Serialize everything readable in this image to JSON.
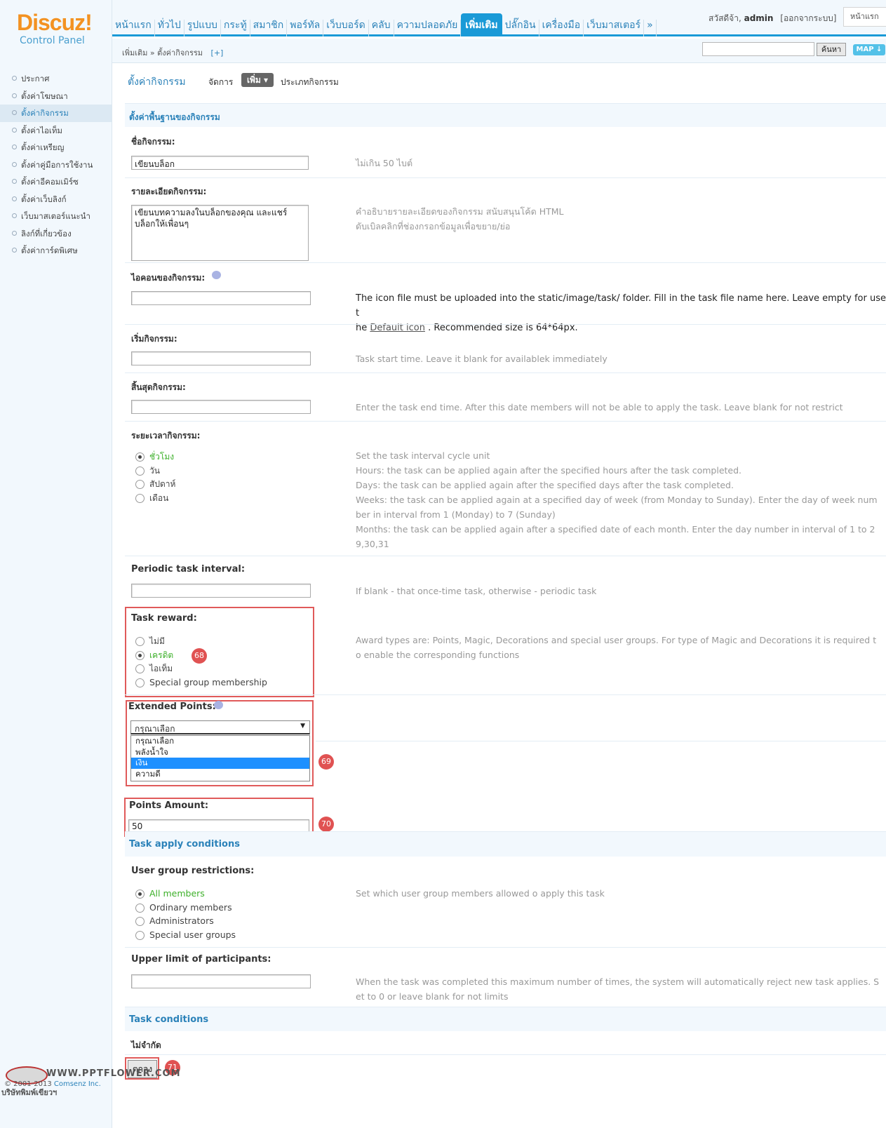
{
  "logo": {
    "brand": "Discuz!",
    "subtitle": "Control Panel"
  },
  "nav": {
    "tabs": [
      "หน้าแรก",
      "ทั่วไป",
      "รูปแบบ",
      "กระทู้",
      "สมาชิก",
      "พอร์ทัล",
      "เว็บบอร์ด",
      "คลับ",
      "ความปลอดภัย",
      "เพิ่มเติม",
      "ปลั๊กอิน",
      "เครื่องมือ",
      "เว็บมาสเตอร์",
      "»"
    ],
    "active": "เพิ่มเติม"
  },
  "user": {
    "greeting": "สวัสดีจ้า,",
    "name": "admin",
    "logout": "[ออกจากระบบ]",
    "home": "หน้าแรก"
  },
  "breadcrumb": {
    "text": "เพิ่มเติม » ตั้งค่ากิจกรรม",
    "plus": "[+]"
  },
  "search": {
    "button": "ค้นหา",
    "map": "MAP ↓"
  },
  "sidebar": {
    "items": [
      "ประกาศ",
      "ตั้งค่าโฆษณา",
      "ตั้งค่ากิจกรรม",
      "ตั้งค่าไอเท็ม",
      "ตั้งค่าเหรียญ",
      "ตั้งค่าคู่มือการใช้งาน",
      "ตั้งค่าอีคอมเมิร์ซ",
      "ตั้งค่าเว็บลิงก์",
      "เว็บมาสเตอร์แนะนำ",
      "ลิงก์ที่เกี่ยวข้อง",
      "ตั้งค่าการ์ดพิเศษ"
    ],
    "active_index": 2
  },
  "page": {
    "title": "ตั้งค่ากิจกรรม",
    "manage": "จัดการ",
    "add": "เพิ่ม ▾",
    "type": "ประเภทกิจกรรม"
  },
  "sections": {
    "basic": "ตั้งค่าพื้นฐานของกิจกรรม",
    "apply": "Task apply conditions",
    "conditions": "Task conditions"
  },
  "fields": {
    "name": {
      "label": "ชื่อกิจกรรม:",
      "value": "เขียนบล็อก",
      "hint": "ไม่เกิน 50 ไบต์"
    },
    "desc": {
      "label": "รายละเอียดกิจกรรม:",
      "value": "เขียนบทความลงในบล็อกของคุณ และแชร์บล็อกให้เพื่อนๆ",
      "hint1": "คำอธิบายรายละเอียดของกิจกรรม สนับสนุนโค้ด HTML",
      "hint2": "ดับเบิลคลิกที่ช่องกรอกข้อมูลเพื่อขยาย/ย่อ"
    },
    "icon": {
      "label": "ไอคอนของกิจกรรม:",
      "value": "",
      "hint_pre": "The icon file must be uploaded into the static/image/task/ folder. Fill in the task file name here. Leave empty for use t",
      "hint_mid": "he ",
      "link": "Default icon",
      "hint_post": ". Recommended size is 64*64px."
    },
    "start": {
      "label": "เริ่มกิจกรรม:",
      "value": "",
      "hint": "Task start time. Leave it blank for availablek immediately"
    },
    "end": {
      "label": "สิ้นสุดกิจกรรม:",
      "value": "",
      "hint": "Enter the task end time. After this date members will not be able to apply the task. Leave blank for not restrict"
    },
    "period": {
      "label": "ระยะเวลากิจกรรม:",
      "options": [
        "ชั่วโมง",
        "วัน",
        "สัปดาห์",
        "เดือน"
      ],
      "selected": 0,
      "hints": [
        "Set the task interval cycle unit",
        "Hours: the task can be applied again after the specified hours after the task completed.",
        "Days: the task can be applied again after the specified days after the task completed.",
        "Weeks: the task can be applied again at a specified day of week (from Monday to Sunday). Enter the day of week num",
        "ber in interval from 1 (Monday) to 7 (Sunday)",
        "Months: the task can be applied again after a specified date of each month. Enter the day number in interval of 1 to 2",
        "9,30,31"
      ]
    },
    "interval": {
      "label": "Periodic task interval:",
      "value": "",
      "hint": "If blank - that once-time task, otherwise - periodic task"
    },
    "reward": {
      "label": "Task reward:",
      "options": [
        "ไม่มี",
        "เครดิต",
        "ไอเท็ม",
        "Special group membership"
      ],
      "selected": 1,
      "hint1": "Award types are: Points, Magic, Decorations and special user groups. For type of Magic and Decorations it is required t",
      "hint2": "o enable the corresponding functions"
    },
    "extpoints": {
      "label": "Extended Points:",
      "selected": "กรุณาเลือก",
      "options": [
        "กรุณาเลือก",
        "พลังน้ำใจ",
        "เงิน",
        "ความดี"
      ],
      "highlight": 2
    },
    "amount": {
      "label": "Points Amount:",
      "value": "50"
    },
    "groups": {
      "label": "User group restrictions:",
      "options": [
        "All members",
        "Ordinary members",
        "Administrators",
        "Special user groups"
      ],
      "selected": 0,
      "hint": "Set which user group members allowed o apply this task"
    },
    "limit": {
      "label": "Upper limit of participants:",
      "value": "",
      "hint1": "When the task was completed this maximum number of times, the system will automatically reject new task applies. S",
      "hint2": "et to 0 or leave blank for not limits"
    },
    "nolimit": {
      "label": "ไม่จำกัด"
    }
  },
  "submit": {
    "label": "ตกลง"
  },
  "badges": [
    "68",
    "69",
    "70",
    "71"
  ],
  "footer": {
    "watermark": "WWW.PPTFLOWER.COM",
    "copyright_pre": "© 2001-2013 ",
    "copyright_link": "Comsenz Inc.",
    "watermark_sub": "บริษัทพิมพ์เขียวฯ"
  },
  "colors": {
    "accent": "#1a9ad7",
    "link": "#2b82b9",
    "checked": "#3db02a",
    "badge": "#e05252",
    "logo": "#f39222"
  }
}
